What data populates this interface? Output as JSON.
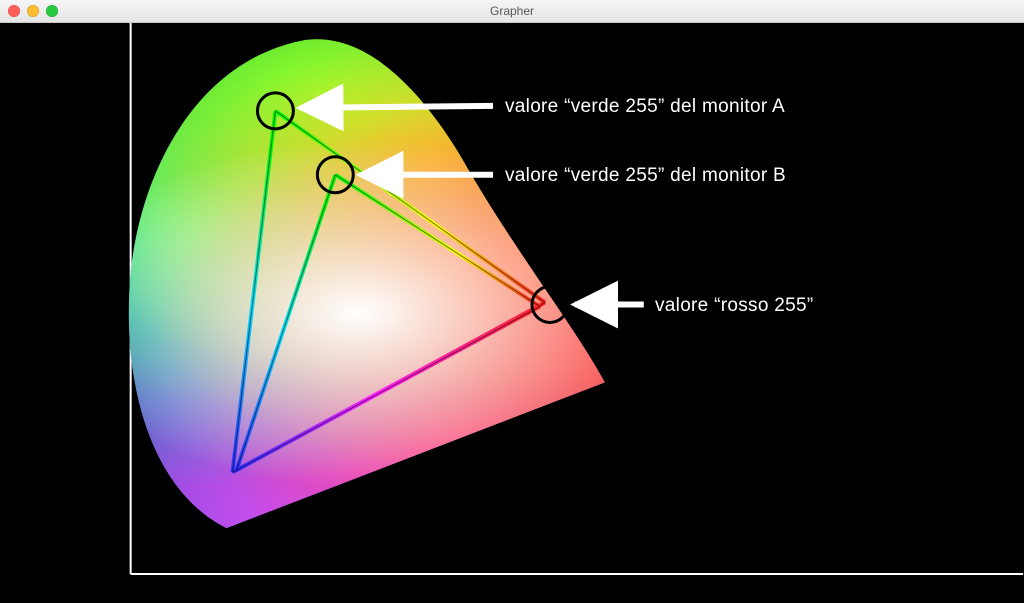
{
  "window": {
    "title": "Grapher"
  },
  "labels": {
    "greenA": "valore “verde 255” del monitor A",
    "greenB": "valore “verde 255” del monitor B",
    "red": "valore “rosso 255”"
  },
  "diagram": {
    "description": "CIE xy chromaticity horseshoe showing gamut triangles of two monitors. Circles mark the green primary of monitor A (outer triangle), the green primary of monitor B (inner triangle), and the shared red primary.",
    "triangles": {
      "monitorA": {
        "green": [
          275,
          88
        ],
        "red": [
          545,
          280
        ],
        "blue": [
          232,
          450
        ]
      },
      "monitorB": {
        "green": [
          335,
          152
        ],
        "red": [
          540,
          284
        ],
        "blue": [
          236,
          448
        ]
      }
    },
    "markers": {
      "greenA": [
        275,
        88
      ],
      "greenB": [
        335,
        152
      ],
      "red": [
        550,
        282
      ]
    }
  }
}
